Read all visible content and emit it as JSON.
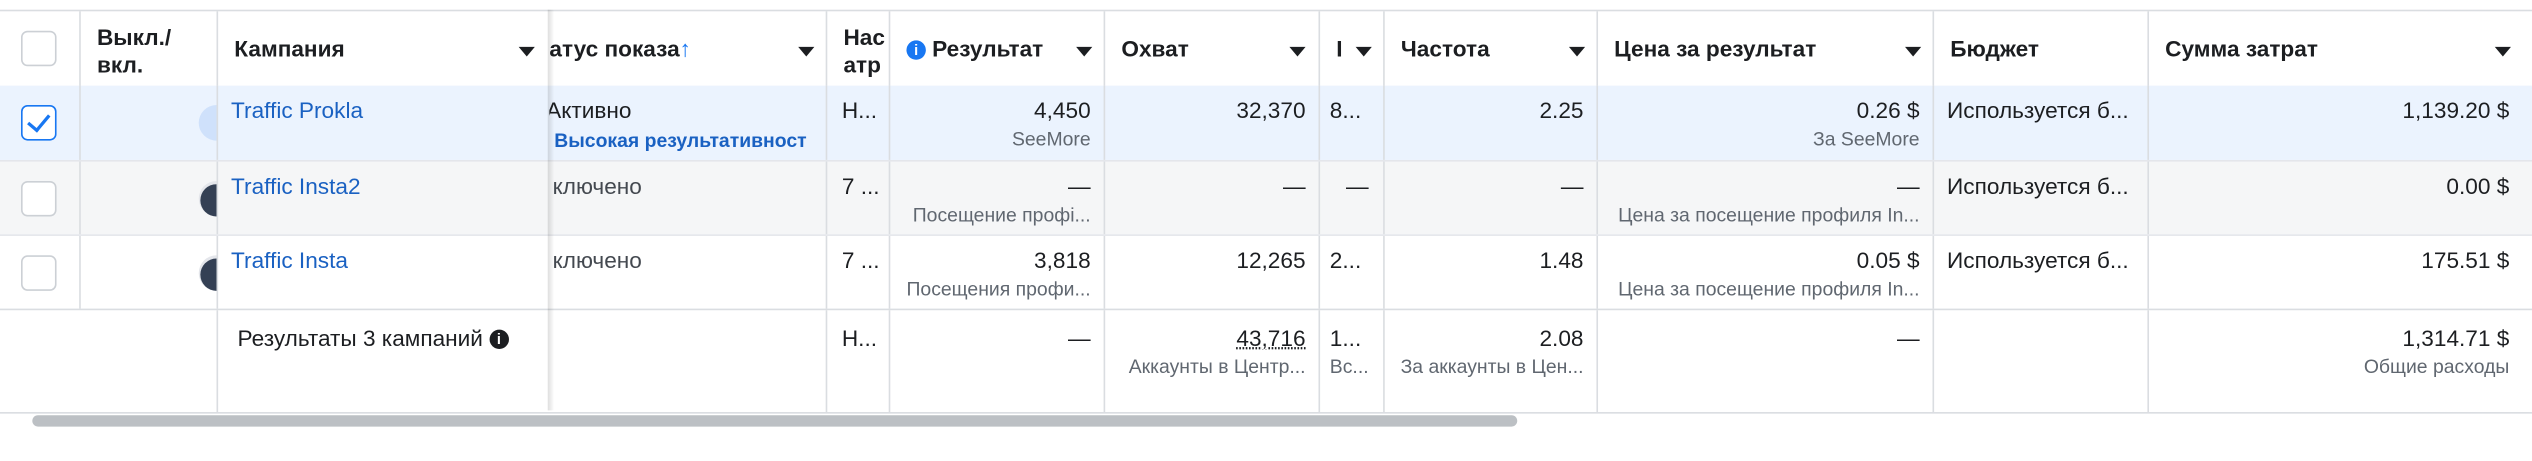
{
  "header": {
    "toggle_col_line1": "Выкл./",
    "toggle_col_line2": "вкл.",
    "campaign": "Кампания",
    "status": "атус показа",
    "status_sort_arrow": "↑",
    "attribution_line1": "Нас",
    "attribution_line2": "атр",
    "result": "Результат",
    "reach": "Охват",
    "impressions": "I",
    "frequency": "Частота",
    "cost_per_result": "Цена за результат",
    "budget": "Бюджет",
    "amount_spent": "Сумма затрат"
  },
  "rows": [
    {
      "selected": true,
      "toggle_on": true,
      "campaign": "Traffic Prokla",
      "status": "Активно",
      "status_note": "Высокая результативност",
      "attribution": "Н...",
      "result": "4,450",
      "result_sub": "SeeMore",
      "reach": "32,370",
      "impressions": "8...",
      "frequency": "2.25",
      "cost": "0.26 $",
      "cost_sub": "За SeeMore",
      "budget": "Используется б...",
      "spent": "1,139.20 $"
    },
    {
      "selected": false,
      "toggle_on": false,
      "campaign": "Traffic Insta2",
      "status": "ключено",
      "attribution": "7 ...",
      "result": "—",
      "result_sub": "Посещение профі...",
      "reach": "—",
      "impressions": "—",
      "frequency": "—",
      "cost": "—",
      "cost_sub": "Цена за посещение профиля In...",
      "budget": "Используется б...",
      "spent": "0.00 $"
    },
    {
      "selected": false,
      "toggle_on": false,
      "campaign": "Traffic Insta",
      "status": "ключено",
      "attribution": "7 ...",
      "result": "3,818",
      "result_sub": "Посещения профи...",
      "reach": "12,265",
      "impressions": "2...",
      "frequency": "1.48",
      "cost": "0.05 $",
      "cost_sub": "Цена за посещение профиля In...",
      "budget": "Используется б...",
      "spent": "175.51 $"
    }
  ],
  "totals": {
    "label": "Результаты 3 кампаний",
    "attribution": "Н...",
    "result": "—",
    "reach": "43,716",
    "reach_sub": "Аккаунты в Центр...",
    "impressions": "1...",
    "impressions_sub": "Вс...",
    "frequency": "2.08",
    "frequency_sub": "За аккаунты в Цен...",
    "cost": "—",
    "spent": "1,314.71 $",
    "spent_sub": "Общие расходы"
  },
  "colors": {
    "accent": "#1877f2",
    "link": "#1a61c2",
    "selected_row": "#ebf3fe"
  }
}
